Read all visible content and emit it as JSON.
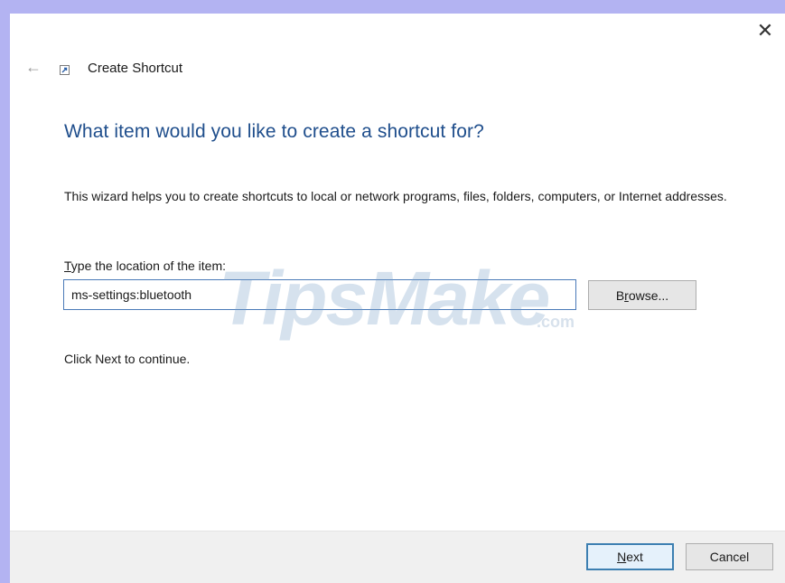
{
  "window": {
    "close_glyph": "✕",
    "back_glyph": "←",
    "title": "Create Shortcut"
  },
  "content": {
    "heading": "What item would you like to create a shortcut for?",
    "description": "This wizard helps you to create shortcuts to local or network programs, files, folders, computers, or Internet addresses.",
    "field_label_accel": "T",
    "field_label_rest": "ype the location of the item:",
    "location_value": "ms-settings:bluetooth",
    "browse_accel": "r",
    "browse_pre": "B",
    "browse_post": "owse...",
    "continue_text": "Click Next to continue."
  },
  "watermark": {
    "text": "TipsMake",
    "suffix": ".com"
  },
  "footer": {
    "next_accel": "N",
    "next_rest": "ext",
    "cancel_label": "Cancel"
  },
  "colors": {
    "accent_border": "#b3b3f2",
    "heading": "#1f4e8c",
    "input_border": "#4a7ab8",
    "default_button_border": "#3c7fb1"
  }
}
